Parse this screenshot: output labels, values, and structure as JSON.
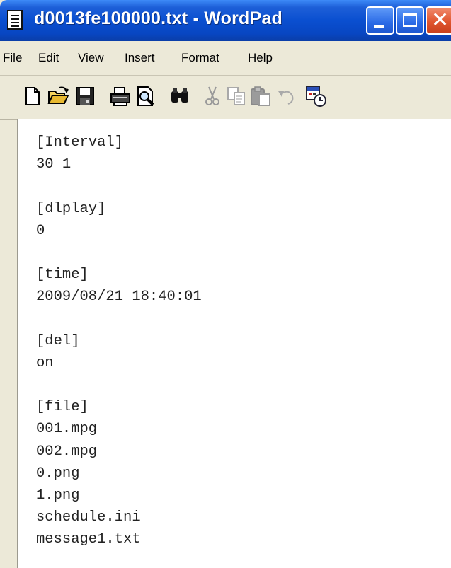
{
  "window": {
    "title": "d0013fe100000.txt - WordPad"
  },
  "menu": {
    "items": [
      "File",
      "Edit",
      "View",
      "Insert",
      "Format",
      "Help"
    ]
  },
  "toolbar": {
    "icons": [
      "new-icon",
      "open-icon",
      "save-icon",
      "print-icon",
      "print-preview-icon",
      "find-icon",
      "cut-icon",
      "copy-icon",
      "paste-icon",
      "undo-icon",
      "date-time-icon"
    ]
  },
  "document": {
    "lines": [
      "[Interval]",
      "30 1",
      "",
      "[dlplay]",
      "0",
      "",
      "[time]",
      "2009/08/21 18:40:01",
      "",
      "[del]",
      "on",
      "",
      "[file]",
      "001.mpg",
      "002.mpg",
      "0.png",
      "1.png",
      "schedule.ini",
      "message1.txt"
    ]
  },
  "colors": {
    "titlebar": "#0a4fd0",
    "window_bg": "#ece9d8",
    "close_button": "#e0552e"
  }
}
